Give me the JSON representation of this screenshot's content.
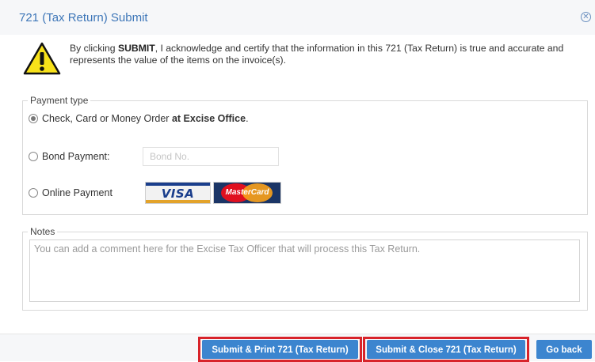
{
  "dialog": {
    "title": "721 (Tax Return) Submit",
    "close_icon": "close-circle-icon",
    "warning_icon": "warning-triangle-icon"
  },
  "notice": {
    "prefix": "By clicking ",
    "bold": "SUBMIT",
    "suffix": ", I acknowledge and certify that the information in this 721 (Tax Return) is true and accurate and represents the value of the items on the invoice(s)."
  },
  "payment": {
    "legend": "Payment type",
    "option_office": {
      "prefix": "Check, Card or Money Order ",
      "bold": "at Excise Office",
      "suffix": ".",
      "selected": true
    },
    "option_bond": {
      "label": "Bond Payment:",
      "placeholder": "Bond No.",
      "value": "",
      "selected": false
    },
    "option_online": {
      "label": "Online Payment",
      "selected": false,
      "cards": [
        "VISA",
        "MasterCard"
      ]
    }
  },
  "notes": {
    "legend": "Notes",
    "placeholder": "You can add a comment here for the Excise Tax Officer that will process this Tax Return.",
    "value": ""
  },
  "footer": {
    "print_label": "Submit & Print 721 (Tax Return)",
    "close_label": "Submit & Close 721 (Tax Return)",
    "back_label": "Go back"
  },
  "colors": {
    "title": "#3d76b8",
    "button": "#3c85cf",
    "highlight": "#d8232a"
  }
}
